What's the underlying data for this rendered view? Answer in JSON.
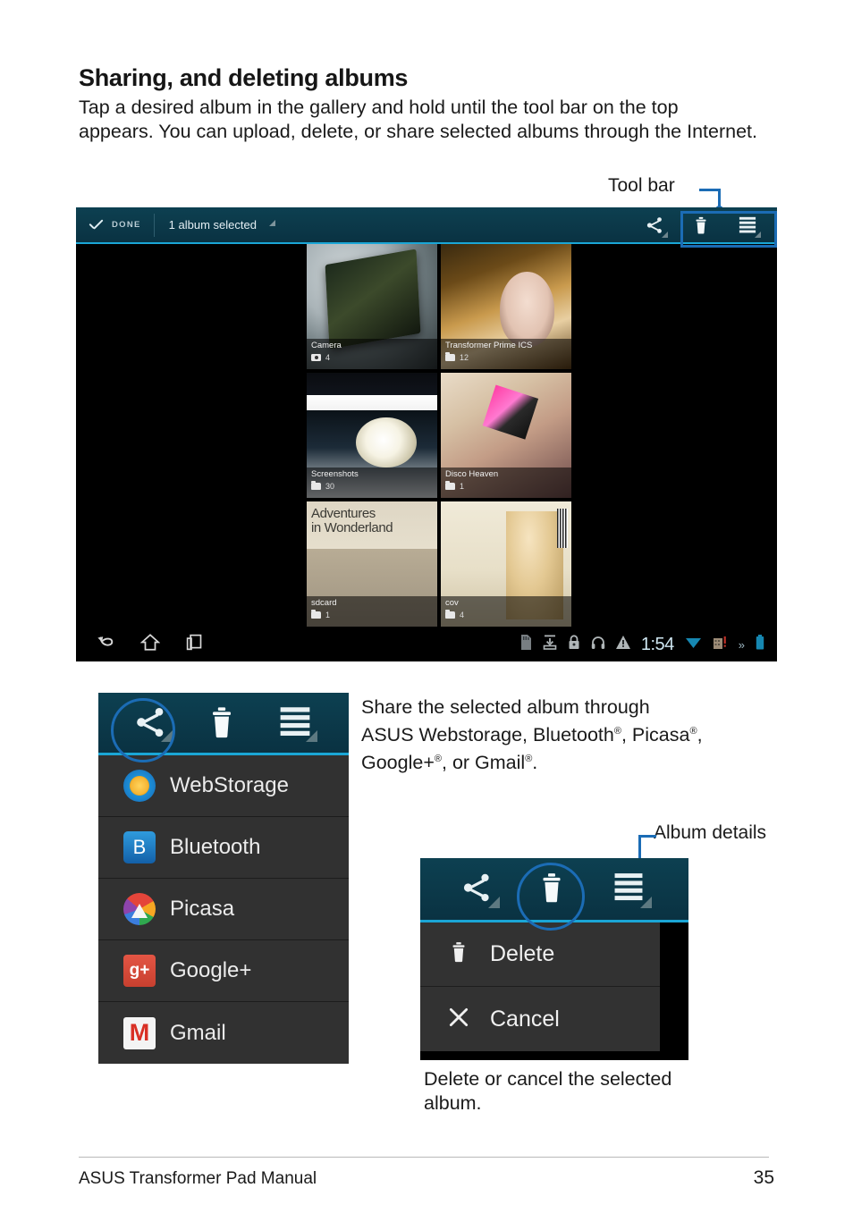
{
  "heading": "Sharing, and deleting albums",
  "intro": "Tap a desired album in the gallery and hold until the tool bar on the top appears. You can upload, delete, or share selected albums through the Internet.",
  "callouts": {
    "toolbar": "Tool bar",
    "album_details": "Album details"
  },
  "gallery_screenshot": {
    "toolbar": {
      "done_label": "DONE",
      "selection_label": "1 album selected",
      "check_icon": "check-icon",
      "dropdown_icon": "dropdown-corner-icon",
      "icons": [
        "share-icon",
        "trash-icon",
        "menu-icon"
      ]
    },
    "albums": [
      {
        "name": "Camera",
        "count": "4",
        "type_icon": "camera-icon",
        "selected": false
      },
      {
        "name": "Transformer Prime ICS",
        "count": "12",
        "type_icon": "folder-icon",
        "selected": false
      },
      {
        "name": "Screenshots",
        "count": "30",
        "type_icon": "folder-icon",
        "selected": true
      },
      {
        "name": "Disco Heaven",
        "count": "1",
        "type_icon": "folder-icon",
        "selected": false
      },
      {
        "name": "sdcard",
        "count": "1",
        "type_icon": "folder-icon",
        "selected": false
      },
      {
        "name": "cov",
        "count": "4",
        "type_icon": "folder-icon",
        "selected": false
      }
    ],
    "album_art_text": {
      "wonderland": "Adventures\nin Wonderland"
    },
    "navbar": {
      "left_icons": [
        "back-icon",
        "home-icon",
        "recents-icon"
      ],
      "status_icons": [
        "sdcard-icon",
        "download-icon",
        "lock-icon",
        "headphones-icon",
        "warning-icon"
      ],
      "clock": "1:54",
      "right_icons": [
        "wifi-icon",
        "sync-alert-icon",
        "chevrons-icon",
        "battery-icon"
      ]
    }
  },
  "share_menu": {
    "toolbar_icons": [
      "share-icon",
      "trash-icon",
      "menu-icon"
    ],
    "highlighted_icon": "share-icon",
    "items": [
      {
        "label": "WebStorage",
        "icon": "webstorage-icon"
      },
      {
        "label": "Bluetooth",
        "icon": "bluetooth-icon"
      },
      {
        "label": "Picasa",
        "icon": "picasa-icon"
      },
      {
        "label": "Google+",
        "icon": "googleplus-icon"
      },
      {
        "label": "Gmail",
        "icon": "gmail-icon"
      }
    ]
  },
  "share_description": "Share the selected album through ASUS Webstorage, Bluetooth®, Picasa®, Google+®, or Gmail®.",
  "delete_menu": {
    "toolbar_icons": [
      "share-icon",
      "trash-icon",
      "menu-icon"
    ],
    "highlighted_icon": "trash-icon",
    "items": [
      {
        "label": "Delete",
        "icon": "trash-icon"
      },
      {
        "label": "Cancel",
        "icon": "close-icon"
      }
    ]
  },
  "delete_description": "Delete or cancel the selected album.",
  "footer": {
    "manual_title": "ASUS Transformer Pad Manual",
    "page_number": "35"
  },
  "colors": {
    "accent_blue": "#1b6cb5",
    "toolbar_teal": "#0b3c4a",
    "toolbar_underline": "#1aa6d6",
    "selection_border": "#2ba7c4"
  }
}
